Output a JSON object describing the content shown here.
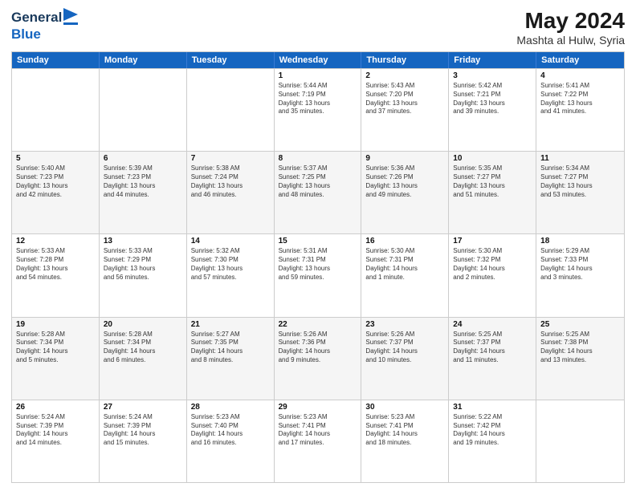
{
  "header": {
    "logo_line1": "General",
    "logo_line2": "Blue",
    "month": "May 2024",
    "location": "Mashta al Hulw, Syria"
  },
  "weekdays": [
    "Sunday",
    "Monday",
    "Tuesday",
    "Wednesday",
    "Thursday",
    "Friday",
    "Saturday"
  ],
  "rows": [
    [
      {
        "day": "",
        "info": ""
      },
      {
        "day": "",
        "info": ""
      },
      {
        "day": "",
        "info": ""
      },
      {
        "day": "1",
        "info": "Sunrise: 5:44 AM\nSunset: 7:19 PM\nDaylight: 13 hours\nand 35 minutes."
      },
      {
        "day": "2",
        "info": "Sunrise: 5:43 AM\nSunset: 7:20 PM\nDaylight: 13 hours\nand 37 minutes."
      },
      {
        "day": "3",
        "info": "Sunrise: 5:42 AM\nSunset: 7:21 PM\nDaylight: 13 hours\nand 39 minutes."
      },
      {
        "day": "4",
        "info": "Sunrise: 5:41 AM\nSunset: 7:22 PM\nDaylight: 13 hours\nand 41 minutes."
      }
    ],
    [
      {
        "day": "5",
        "info": "Sunrise: 5:40 AM\nSunset: 7:23 PM\nDaylight: 13 hours\nand 42 minutes."
      },
      {
        "day": "6",
        "info": "Sunrise: 5:39 AM\nSunset: 7:23 PM\nDaylight: 13 hours\nand 44 minutes."
      },
      {
        "day": "7",
        "info": "Sunrise: 5:38 AM\nSunset: 7:24 PM\nDaylight: 13 hours\nand 46 minutes."
      },
      {
        "day": "8",
        "info": "Sunrise: 5:37 AM\nSunset: 7:25 PM\nDaylight: 13 hours\nand 48 minutes."
      },
      {
        "day": "9",
        "info": "Sunrise: 5:36 AM\nSunset: 7:26 PM\nDaylight: 13 hours\nand 49 minutes."
      },
      {
        "day": "10",
        "info": "Sunrise: 5:35 AM\nSunset: 7:27 PM\nDaylight: 13 hours\nand 51 minutes."
      },
      {
        "day": "11",
        "info": "Sunrise: 5:34 AM\nSunset: 7:27 PM\nDaylight: 13 hours\nand 53 minutes."
      }
    ],
    [
      {
        "day": "12",
        "info": "Sunrise: 5:33 AM\nSunset: 7:28 PM\nDaylight: 13 hours\nand 54 minutes."
      },
      {
        "day": "13",
        "info": "Sunrise: 5:33 AM\nSunset: 7:29 PM\nDaylight: 13 hours\nand 56 minutes."
      },
      {
        "day": "14",
        "info": "Sunrise: 5:32 AM\nSunset: 7:30 PM\nDaylight: 13 hours\nand 57 minutes."
      },
      {
        "day": "15",
        "info": "Sunrise: 5:31 AM\nSunset: 7:31 PM\nDaylight: 13 hours\nand 59 minutes."
      },
      {
        "day": "16",
        "info": "Sunrise: 5:30 AM\nSunset: 7:31 PM\nDaylight: 14 hours\nand 1 minute."
      },
      {
        "day": "17",
        "info": "Sunrise: 5:30 AM\nSunset: 7:32 PM\nDaylight: 14 hours\nand 2 minutes."
      },
      {
        "day": "18",
        "info": "Sunrise: 5:29 AM\nSunset: 7:33 PM\nDaylight: 14 hours\nand 3 minutes."
      }
    ],
    [
      {
        "day": "19",
        "info": "Sunrise: 5:28 AM\nSunset: 7:34 PM\nDaylight: 14 hours\nand 5 minutes."
      },
      {
        "day": "20",
        "info": "Sunrise: 5:28 AM\nSunset: 7:34 PM\nDaylight: 14 hours\nand 6 minutes."
      },
      {
        "day": "21",
        "info": "Sunrise: 5:27 AM\nSunset: 7:35 PM\nDaylight: 14 hours\nand 8 minutes."
      },
      {
        "day": "22",
        "info": "Sunrise: 5:26 AM\nSunset: 7:36 PM\nDaylight: 14 hours\nand 9 minutes."
      },
      {
        "day": "23",
        "info": "Sunrise: 5:26 AM\nSunset: 7:37 PM\nDaylight: 14 hours\nand 10 minutes."
      },
      {
        "day": "24",
        "info": "Sunrise: 5:25 AM\nSunset: 7:37 PM\nDaylight: 14 hours\nand 11 minutes."
      },
      {
        "day": "25",
        "info": "Sunrise: 5:25 AM\nSunset: 7:38 PM\nDaylight: 14 hours\nand 13 minutes."
      }
    ],
    [
      {
        "day": "26",
        "info": "Sunrise: 5:24 AM\nSunset: 7:39 PM\nDaylight: 14 hours\nand 14 minutes."
      },
      {
        "day": "27",
        "info": "Sunrise: 5:24 AM\nSunset: 7:39 PM\nDaylight: 14 hours\nand 15 minutes."
      },
      {
        "day": "28",
        "info": "Sunrise: 5:23 AM\nSunset: 7:40 PM\nDaylight: 14 hours\nand 16 minutes."
      },
      {
        "day": "29",
        "info": "Sunrise: 5:23 AM\nSunset: 7:41 PM\nDaylight: 14 hours\nand 17 minutes."
      },
      {
        "day": "30",
        "info": "Sunrise: 5:23 AM\nSunset: 7:41 PM\nDaylight: 14 hours\nand 18 minutes."
      },
      {
        "day": "31",
        "info": "Sunrise: 5:22 AM\nSunset: 7:42 PM\nDaylight: 14 hours\nand 19 minutes."
      },
      {
        "day": "",
        "info": ""
      }
    ]
  ]
}
